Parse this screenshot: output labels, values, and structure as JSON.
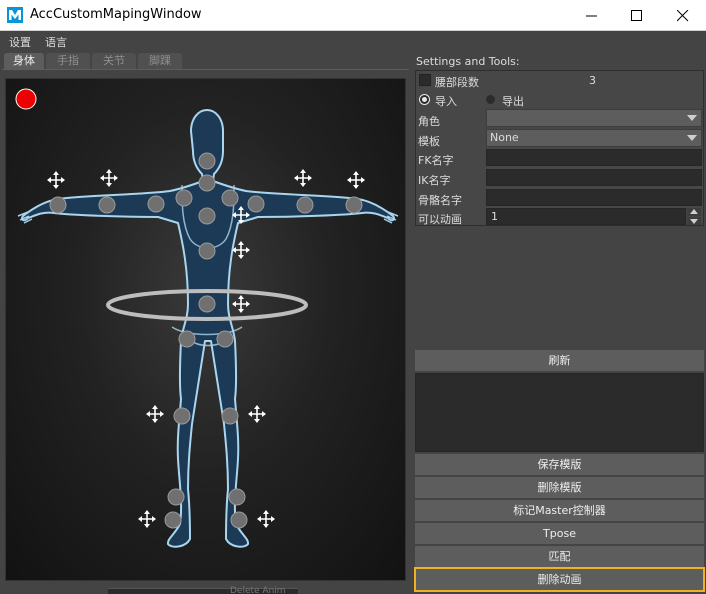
{
  "window": {
    "title": "AccCustomMapingWindow"
  },
  "menu": [
    "设置",
    "语言"
  ],
  "tabs": [
    "身体",
    "手指",
    "关节",
    "脚踝"
  ],
  "left": {
    "bottom_text": "Delete Anim"
  },
  "settings": {
    "header": "Settings and Tools:",
    "waist_label": "腰部段数",
    "waist_value": "3",
    "import_label": "导入",
    "export_label": "导出",
    "role_label": "角色",
    "role_value": "",
    "template_label": "模板",
    "template_value": "None",
    "fk_label": "FK名字",
    "ik_label": "IK名字",
    "bone_label": "骨骼名字",
    "anim_label": "可以动画",
    "anim_value": "1"
  },
  "buttons": {
    "refresh": "刷新",
    "save_template": "保存模版",
    "delete_template": "删除模版",
    "mark_master": "标记Master控制器",
    "tpose": "Tpose",
    "match": "匹配",
    "delete_anim": "删除动画"
  },
  "colors": {
    "body_fill": "#1c3a56",
    "body_outline": "#a9d5ee",
    "joint": "#707070",
    "record_dot": "#ee0000",
    "highlight": "#f0b21e"
  }
}
